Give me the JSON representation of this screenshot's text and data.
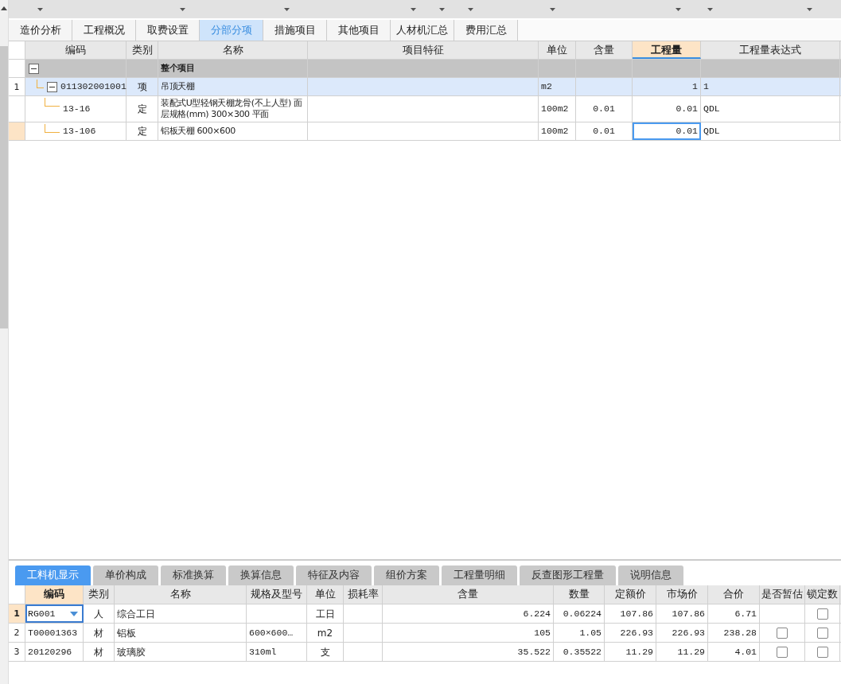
{
  "main_tabs": [
    {
      "label": "造价分析",
      "selected": false
    },
    {
      "label": "工程概况",
      "selected": false
    },
    {
      "label": "取费设置",
      "selected": false
    },
    {
      "label": "分部分项",
      "selected": true
    },
    {
      "label": "措施项目",
      "selected": false
    },
    {
      "label": "其他项目",
      "selected": false
    },
    {
      "label": "人材机汇总",
      "selected": false
    },
    {
      "label": "费用汇总",
      "selected": false
    }
  ],
  "table": {
    "columns": [
      {
        "label": "编码",
        "active": false
      },
      {
        "label": "类别",
        "active": false
      },
      {
        "label": "名称",
        "active": false
      },
      {
        "label": "项目特征",
        "active": false
      },
      {
        "label": "单位",
        "active": false
      },
      {
        "label": "含量",
        "active": false
      },
      {
        "label": "工程量",
        "active": true
      },
      {
        "label": "工程量表达式",
        "active": false
      }
    ],
    "rows": [
      {
        "name": "整个项目",
        "expanded": true,
        "selected": false,
        "current": false,
        "children": [
          {
            "row_number": "1",
            "code": "011302001001",
            "type": "项",
            "name": "吊顶天棚",
            "unit": "m2",
            "quantity": "1",
            "expression": "1",
            "expanded": true,
            "selected": true,
            "current": false,
            "children": [
              {
                "code": "13-16",
                "type": "定",
                "name": "装配式U型轻钢天棚龙骨(不上人型) 面层规格(mm) 300×300 平面",
                "unit": "100m2",
                "content": "0.01",
                "quantity": "0.01",
                "expression": "QDL",
                "selected": false,
                "current": false
              },
              {
                "code": "13-106",
                "type": "定",
                "name": "铝板天棚 600×600",
                "unit": "100m2",
                "content": "0.01",
                "quantity": "0.01",
                "expression": "QDL",
                "selected": false,
                "current": true
              }
            ]
          }
        ]
      }
    ]
  },
  "detail_tabs": [
    {
      "label": "工料机显示",
      "selected": true
    },
    {
      "label": "单价构成",
      "selected": false
    },
    {
      "label": "标准换算",
      "selected": false
    },
    {
      "label": "换算信息",
      "selected": false
    },
    {
      "label": "特征及内容",
      "selected": false
    },
    {
      "label": "组价方案",
      "selected": false
    },
    {
      "label": "工程量明细",
      "selected": false
    },
    {
      "label": "反查图形工程量",
      "selected": false
    },
    {
      "label": "说明信息",
      "selected": false
    }
  ],
  "detail_table": {
    "columns": [
      {
        "label": "编码",
        "active": true
      },
      {
        "label": "类别",
        "active": false
      },
      {
        "label": "名称",
        "active": false
      },
      {
        "label": "规格及型号",
        "active": false
      },
      {
        "label": "单位",
        "active": false
      },
      {
        "label": "损耗率",
        "active": false
      },
      {
        "label": "含量",
        "active": false
      },
      {
        "label": "数量",
        "active": false
      },
      {
        "label": "定额价",
        "active": false
      },
      {
        "label": "市场价",
        "active": false
      },
      {
        "label": "合价",
        "active": false
      },
      {
        "label": "是否暂估",
        "active": false
      },
      {
        "label": "锁定数",
        "active": false
      }
    ],
    "rows": [
      {
        "row_number": "1",
        "code": "RG001",
        "type": "人",
        "name": "综合工日",
        "unit": "工日",
        "content": "6.224",
        "amount": "0.06224",
        "norm_price": "107.86",
        "market_price": "107.86",
        "total": "6.71",
        "locked": false,
        "current": true
      },
      {
        "row_number": "2",
        "code": "T00001363",
        "type": "材",
        "name": "铝板",
        "spec": "600×600…",
        "unit": "m2",
        "content": "105",
        "amount": "1.05",
        "norm_price": "226.93",
        "market_price": "226.93",
        "total": "238.28",
        "estimated": false,
        "locked": false,
        "current": false
      },
      {
        "row_number": "3",
        "code": "20120296",
        "type": "材",
        "name": "玻璃胶",
        "spec": "310ml",
        "unit": "支",
        "content": "35.522",
        "amount": "0.35522",
        "norm_price": "11.29",
        "market_price": "11.29",
        "total": "4.01",
        "estimated": false,
        "locked": false,
        "current": false
      }
    ]
  }
}
